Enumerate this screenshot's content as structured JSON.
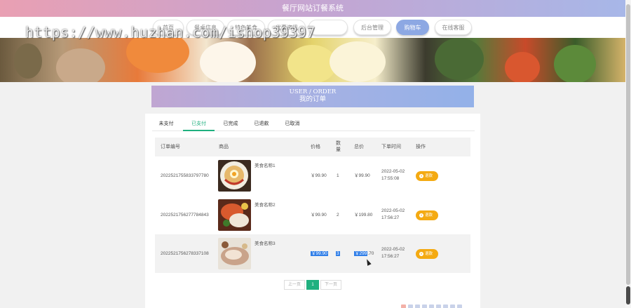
{
  "app": {
    "title": "餐厅网站订餐系统"
  },
  "nav": [
    {
      "label": "首页",
      "active": false
    },
    {
      "label": "餐桌信息",
      "active": false
    },
    {
      "label": "特色美食",
      "active": false
    },
    {
      "label": "优惠资讯",
      "active": false
    },
    {
      "label": "",
      "active": false
    },
    {
      "label": "后台管理",
      "active": false
    },
    {
      "label": "购物车",
      "active": true
    },
    {
      "label": "在线客服",
      "active": false
    }
  ],
  "watermark": "https://www.huzhan.com/ishop39397",
  "section": {
    "title_en": "USER / ORDER",
    "title_zh": "我的订单"
  },
  "tabs": [
    {
      "label": "未支付",
      "active": false
    },
    {
      "label": "已支付",
      "active": true
    },
    {
      "label": "已完成",
      "active": false
    },
    {
      "label": "已退款",
      "active": false
    },
    {
      "label": "已取消",
      "active": false
    }
  ],
  "table": {
    "headers": {
      "order_no": "订单编号",
      "goods": "商品",
      "price": "价格",
      "qty": "数量",
      "total": "总价",
      "time": "下单时间",
      "action": "操作"
    },
    "rows": [
      {
        "order_no": "20225217558337977​80",
        "goods_name": "美食名称1",
        "price": "￥99.90",
        "qty": "1",
        "total": "￥99.90",
        "date": "2022-05-02",
        "clock": "17:55:08",
        "action": "退款"
      },
      {
        "order_no": "2022521756277784843",
        "goods_name": "美食名称2",
        "price": "￥99.90",
        "qty": "2",
        "total": "￥199.80",
        "date": "2022-05-02",
        "clock": "17:56:27",
        "action": "退款"
      },
      {
        "order_no": "2022521756278337108",
        "goods_name": "美食名称3",
        "price": "￥99.90",
        "qty": "3",
        "total_sel": "￥299",
        "total_rest": ".70",
        "date": "2022-05-02",
        "clock": "17:56:27",
        "action": "退款"
      }
    ]
  },
  "pagination": {
    "prev": "上一页",
    "current": "1",
    "next": "下一页"
  },
  "colors": {
    "accent_green": "#20b07f",
    "action_orange": "#f4aa12",
    "nav_active": "#8da8e3"
  }
}
